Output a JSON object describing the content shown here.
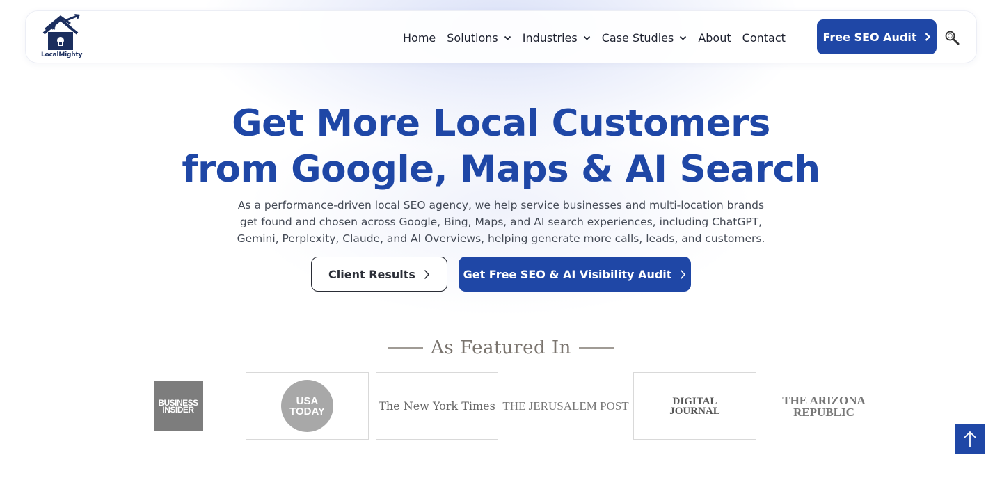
{
  "brand": {
    "name": "LocalMighty",
    "accent": "#1f47a6"
  },
  "nav": {
    "items": [
      {
        "label": "Home",
        "dropdown": false
      },
      {
        "label": "Solutions",
        "dropdown": true
      },
      {
        "label": "Industries",
        "dropdown": true
      },
      {
        "label": "Case Studies",
        "dropdown": true
      },
      {
        "label": "About",
        "dropdown": false
      },
      {
        "label": "Contact",
        "dropdown": false
      }
    ],
    "cta_label": "Free SEO Audit",
    "search_icon": "search-icon"
  },
  "hero": {
    "title_line1": "Get More Local Customers",
    "title_line2": "from Google, Maps & AI Search",
    "description": "As a performance-driven local SEO agency, we help service businesses and multi-location brands get found and chosen across Google, Bing, Maps, and AI search experiences, including ChatGPT, Gemini, Perplexity, Claude, and AI Overviews, helping generate more calls, leads, and customers.",
    "secondary_button": "Client Results",
    "primary_button": "Get Free SEO & AI Visibility Audit"
  },
  "featured": {
    "heading": "As Featured In",
    "logos": {
      "business_insider_line1": "BUSINESS",
      "business_insider_line2": "INSIDER",
      "usa_today_line1": "USA",
      "usa_today_line2": "TODAY",
      "nyt": "The New York Times",
      "jerusalem_post": "THE JERUSALEM POST",
      "digital_journal_line1": "DIGITAL",
      "digital_journal_line2": "JOURNAL",
      "arizona_line1": "THE ARIZONA",
      "arizona_line2": "REPUBLIC"
    }
  },
  "scroll_top_icon": "arrow-up-icon"
}
